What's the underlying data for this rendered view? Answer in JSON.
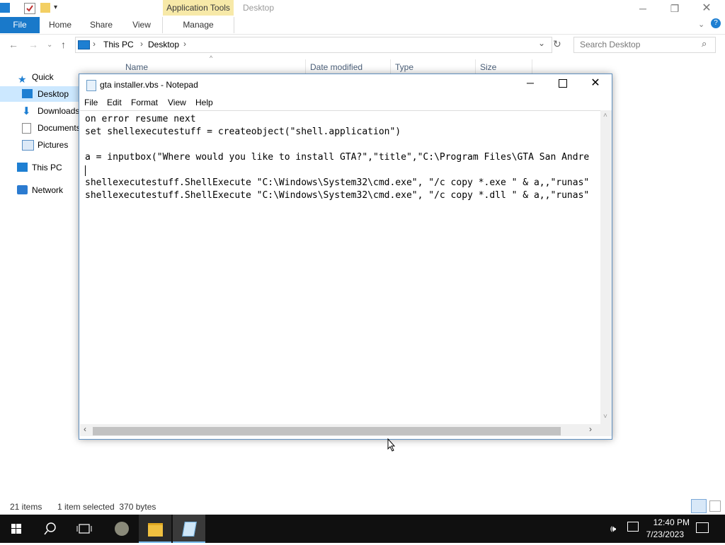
{
  "explorer": {
    "contextual_tab": "Application Tools",
    "window_title": "Desktop",
    "ribbon_tabs": [
      "File",
      "Home",
      "Share",
      "View",
      "Manage"
    ],
    "breadcrumb": [
      "This PC",
      "Desktop"
    ],
    "search_placeholder": "Search Desktop",
    "columns": [
      "Name",
      "Date modified",
      "Type",
      "Size"
    ],
    "nav_items": [
      "Quick access",
      "Desktop",
      "Downloads",
      "Documents",
      "Pictures",
      "This PC",
      "Network"
    ],
    "status": {
      "items": "21 items",
      "selected": "1 item selected  370 bytes"
    }
  },
  "notepad": {
    "title": "gta installer.vbs - Notepad",
    "menu": [
      "File",
      "Edit",
      "Format",
      "View",
      "Help"
    ],
    "lines": [
      "on error resume next",
      "set shellexecutestuff = createobject(\"shell.application\")",
      "",
      "a = inputbox(\"Where would you like to install GTA?\",\"title\",\"C:\\Program Files\\GTA San Andre",
      "",
      "shellexecutestuff.ShellExecute \"C:\\Windows\\System32\\cmd.exe\", \"/c copy *.exe \" & a,,\"runas\"",
      "shellexecutestuff.ShellExecute \"C:\\Windows\\System32\\cmd.exe\", \"/c copy *.dll \" & a,,\"runas\""
    ]
  },
  "taskbar": {
    "time": "12:40 PM",
    "date": "7/23/2023"
  },
  "colors": {
    "accent": "#1979ca",
    "selection": "#cce8ff",
    "taskbar": "#101010",
    "contextual": "#f7e9a8"
  }
}
